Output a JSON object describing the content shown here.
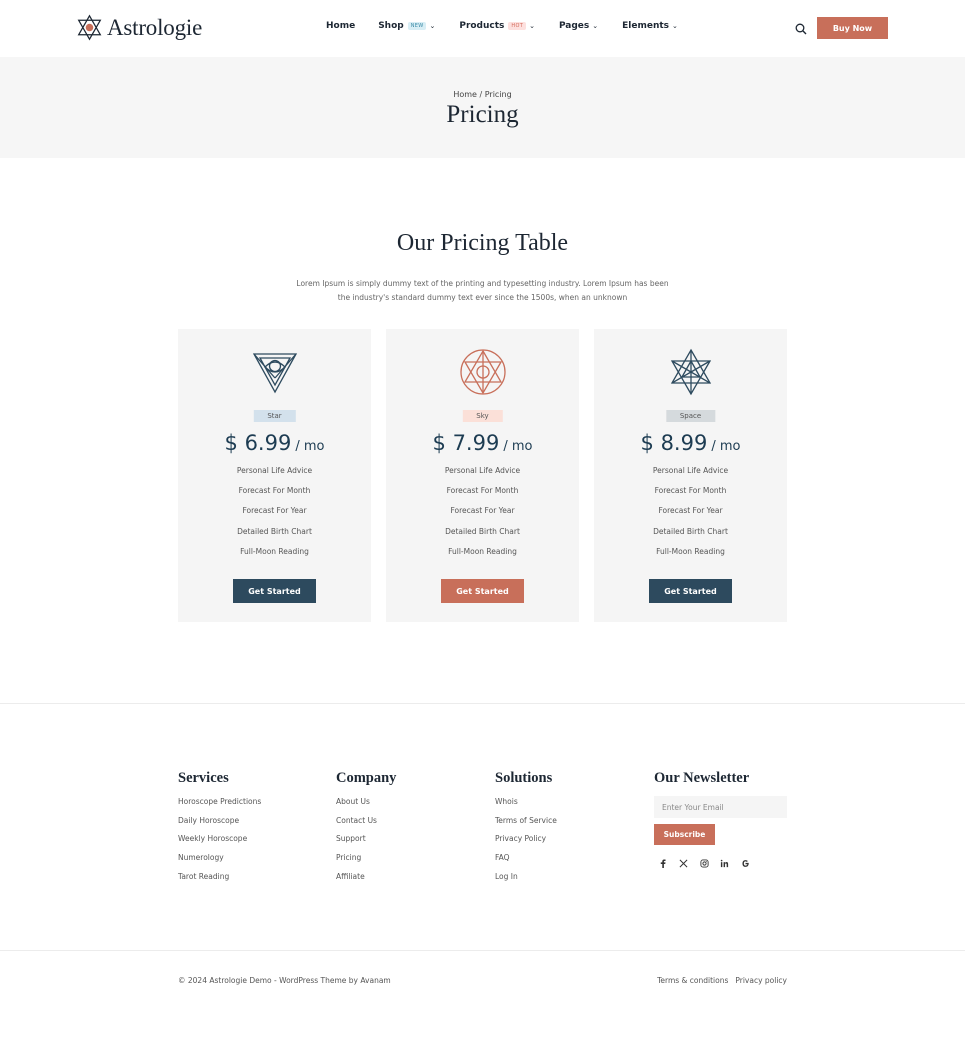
{
  "brand": {
    "name": "Astrologie",
    "accent": "#c86f5a",
    "dark": "#2d4a5e"
  },
  "nav": {
    "items": [
      {
        "label": "Home"
      },
      {
        "label": "Shop",
        "badge": "NEW"
      },
      {
        "label": "Products",
        "badge": "HOT"
      },
      {
        "label": "Pages"
      },
      {
        "label": "Elements"
      }
    ],
    "buy_label": "Buy Now"
  },
  "hero": {
    "breadcrumb_home": "Home",
    "breadcrumb_sep": " / ",
    "breadcrumb_current": "Pricing",
    "title": "Pricing"
  },
  "pricing": {
    "title": "Our Pricing Table",
    "description": "Lorem Ipsum is simply dummy text of the printing and typesetting industry. Lorem Ipsum has been the industry's standard dummy text ever since the 1500s, when an unknown",
    "plans": [
      {
        "name": "Star",
        "price": "$ 6.99",
        "period": "/ mo",
        "icon": "triangle-eye-icon",
        "badge_color": "#d3e1ec",
        "button": "Get Started",
        "button_color": "#2d4a5e",
        "features": [
          "Personal Life Advice",
          "Forecast For Month",
          "Forecast For Year",
          "Detailed Birth Chart",
          "Full-Moon Reading"
        ]
      },
      {
        "name": "Sky",
        "price": "$ 7.99",
        "period": "/ mo",
        "icon": "circle-hexagram-icon",
        "badge_color": "#fbe0d8",
        "button": "Get Started",
        "button_color": "#c86f5a",
        "features": [
          "Personal Life Advice",
          "Forecast For Month",
          "Forecast For Year",
          "Detailed Birth Chart",
          "Full-Moon Reading"
        ]
      },
      {
        "name": "Space",
        "price": "$ 8.99",
        "period": "/ mo",
        "icon": "star-hexagram-icon",
        "badge_color": "#d5dadd",
        "button": "Get Started",
        "button_color": "#2d4a5e",
        "features": [
          "Personal Life Advice",
          "Forecast For Month",
          "Forecast For Year",
          "Detailed Birth Chart",
          "Full-Moon Reading"
        ]
      }
    ]
  },
  "footer": {
    "services": {
      "title": "Services",
      "links": [
        "Horoscope Predictions",
        "Daily Horoscope",
        "Weekly Horoscope",
        "Numerology",
        "Tarot Reading"
      ]
    },
    "company": {
      "title": "Company",
      "links": [
        "About Us",
        "Contact Us",
        "Support",
        "Pricing",
        "Affiliate"
      ]
    },
    "solutions": {
      "title": "Solutions",
      "links": [
        "Whois",
        "Terms of Service",
        "Privacy Policy",
        "FAQ",
        "Log In"
      ]
    },
    "newsletter": {
      "title": "Our Newsletter",
      "placeholder": "Enter Your Email",
      "button": "Subscribe",
      "socials": [
        "facebook-icon",
        "x-icon",
        "instagram-icon",
        "linkedin-icon",
        "google-icon"
      ]
    },
    "copyright": "© 2024 Astrologie Demo - WordPress Theme by Avanam",
    "legal": [
      "Terms & conditions",
      "Privacy policy"
    ]
  }
}
